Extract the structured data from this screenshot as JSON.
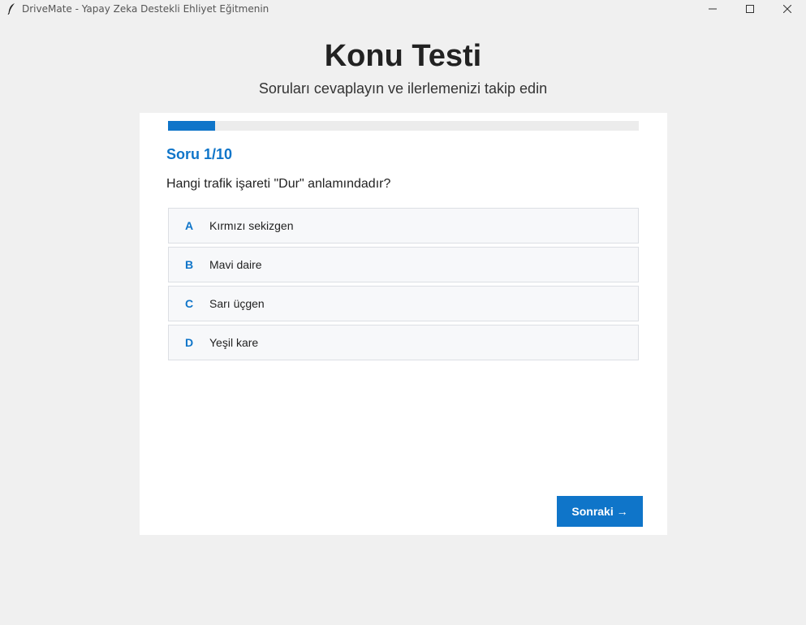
{
  "window": {
    "title": "DriveMate - Yapay Zeka Destekli Ehliyet Eğitmenin",
    "icon": "feather-icon"
  },
  "header": {
    "title": "Konu Testi",
    "subtitle": "Soruları cevaplayın ve ilerlemenizi takip edin"
  },
  "quiz": {
    "progress_fraction": 0.1,
    "question_label": "Soru 1/10",
    "question_text": "Hangi trafik işareti \"Dur\" anlamındadır?",
    "options": [
      {
        "letter": "A",
        "text": "Kırmızı sekizgen"
      },
      {
        "letter": "B",
        "text": "Mavi daire"
      },
      {
        "letter": "C",
        "text": "Sarı üçgen"
      },
      {
        "letter": "D",
        "text": "Yeşil kare"
      }
    ],
    "next_label": "Sonraki →"
  },
  "colors": {
    "accent": "#0f75c9",
    "background": "#f0f0f0",
    "card": "#ffffff",
    "option_bg": "#f7f8fa"
  }
}
